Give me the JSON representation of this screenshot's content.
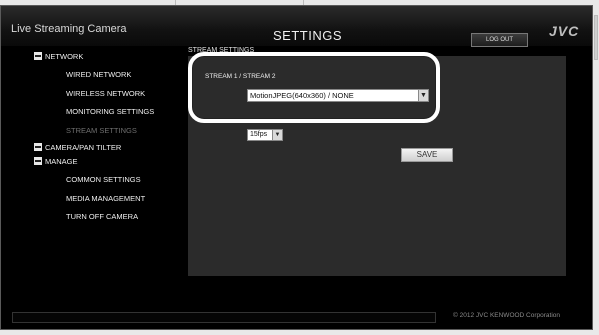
{
  "header": {
    "app_title": "Live Streaming Camera",
    "page_title": "SETTINGS",
    "logout_label": "LOG OUT",
    "logo": "JVC"
  },
  "nav": {
    "sections": [
      {
        "label": "NETWORK",
        "items": [
          "WIRED NETWORK",
          "WIRELESS NETWORK",
          "MONITORING SETTINGS",
          "STREAM SETTINGS"
        ],
        "active": "STREAM SETTINGS"
      },
      {
        "label": "CAMERA/PAN TILTER",
        "items": []
      },
      {
        "label": "MANAGE",
        "items": [
          "COMMON SETTINGS",
          "MEDIA MANAGEMENT",
          "TURN OFF CAMERA"
        ]
      }
    ]
  },
  "main": {
    "panel_title": "STREAM SETTINGS",
    "stream_label": "STREAM 1 / STREAM 2",
    "stream_value": "MotionJPEG(640x360) / NONE",
    "fps_value": "15fps",
    "save_label": "SAVE"
  },
  "footer": {
    "copyright": "© 2012 JVC KENWOOD Corporation"
  },
  "colors": {
    "background": "#000000",
    "panel": "#2b2b2b",
    "highlight": "#ffffff",
    "inactive_nav": "#6f6f6f"
  }
}
